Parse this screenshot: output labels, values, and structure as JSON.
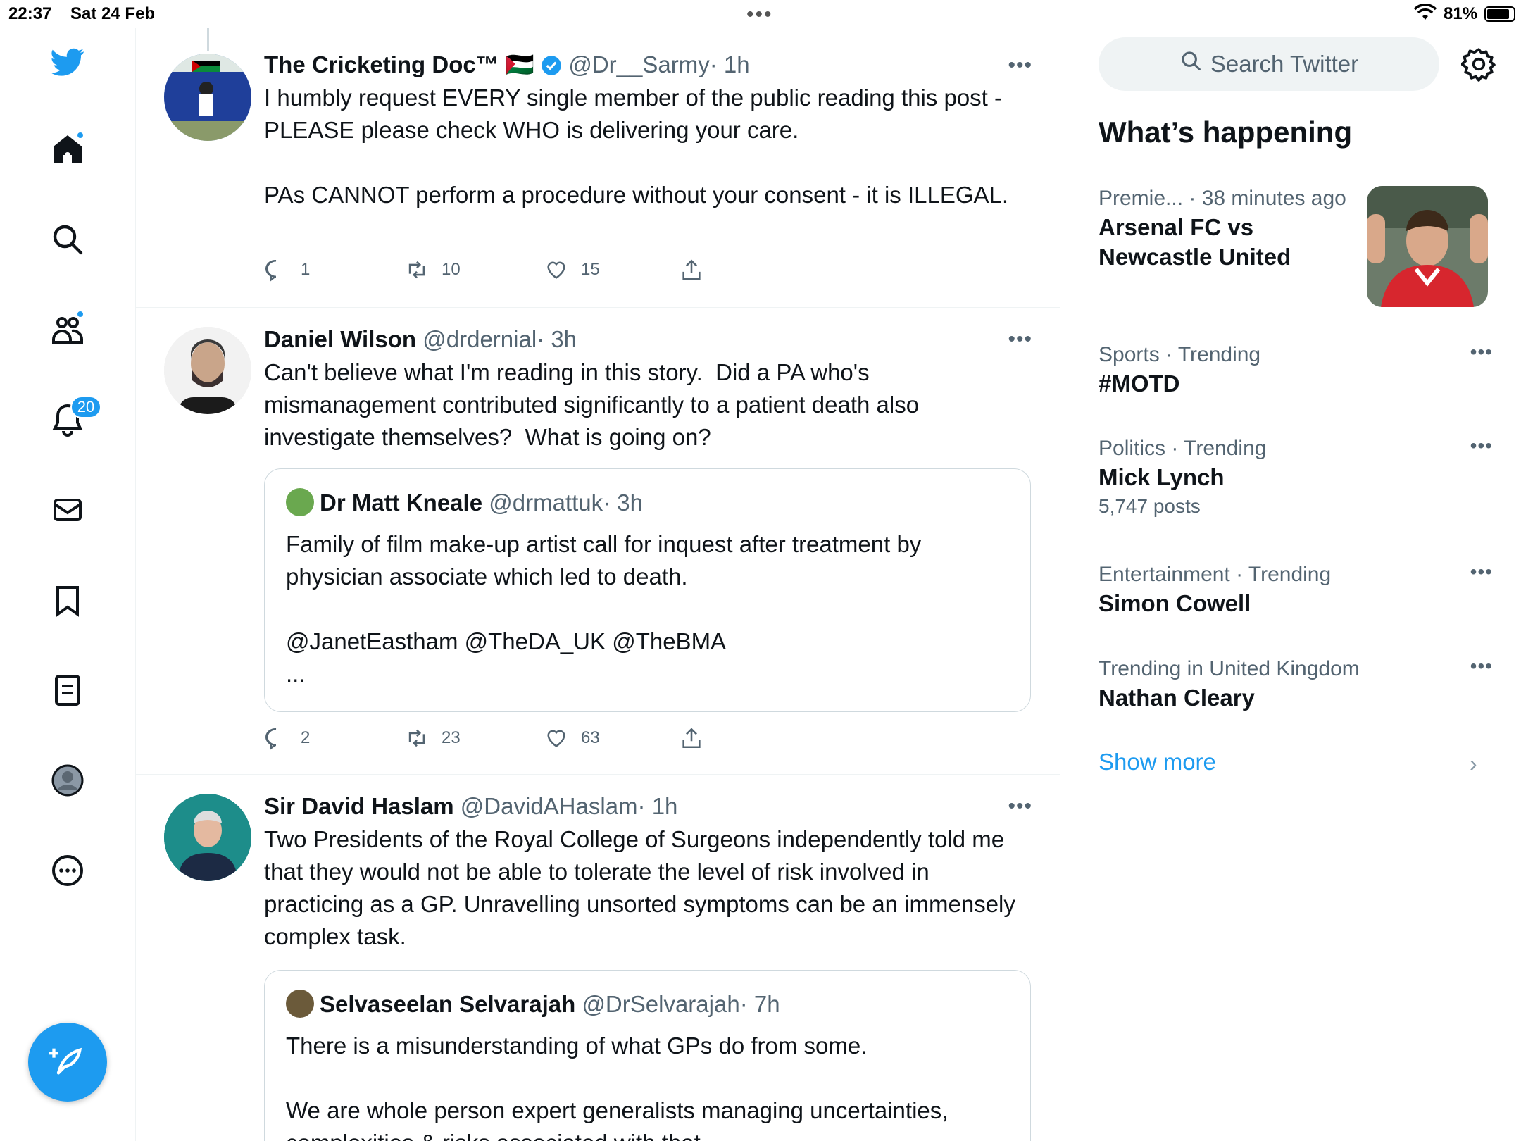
{
  "statusbar": {
    "time": "22:37",
    "date": "Sat 24 Feb",
    "battery": "81%",
    "battery_level": 0.81
  },
  "nav": {
    "items": [
      {
        "name": "twitter-logo-icon"
      },
      {
        "name": "home-icon",
        "dot": true
      },
      {
        "name": "search-icon"
      },
      {
        "name": "communities-icon",
        "dot": true
      },
      {
        "name": "bell-icon",
        "badge": "20"
      },
      {
        "name": "mail-icon"
      },
      {
        "name": "bookmark-icon"
      },
      {
        "name": "lists-icon"
      },
      {
        "name": "profile-icon"
      },
      {
        "name": "more-circle-icon"
      }
    ],
    "compose_icon": "compose-feather-icon"
  },
  "tweets": [
    {
      "name": "The Cricketing Doc™",
      "flag": "🇵🇸",
      "verified": true,
      "handle": "@Dr__Sarmy",
      "time": "· 1h",
      "text": "I humbly request EVERY single member of the public reading this post - PLEASE please check WHO is delivering your care.\n\nPAs CANNOT perform a procedure without your consent - it is ILLEGAL.",
      "replies": "1",
      "retweets": "10",
      "likes": "15"
    },
    {
      "name": "Daniel Wilson",
      "handle": "@drdernial",
      "time": "· 3h",
      "text": "Can't believe what I'm reading in this story.  Did a PA who's mismanagement contributed significantly to a patient death also investigate themselves?  What is going on?",
      "quote": {
        "name": "Dr Matt Kneale",
        "handle": "@drmattuk",
        "time": "· 3h",
        "text": "Family of film make-up artist call for inquest after treatment by physician associate which led to death.\n\n@JanetEastham @TheDA_UK @TheBMA\n..."
      },
      "replies": "2",
      "retweets": "23",
      "likes": "63"
    },
    {
      "name": "Sir David Haslam",
      "handle": "@DavidAHaslam",
      "time": "· 1h",
      "text": "Two Presidents of the Royal College of Surgeons independently told me that they would not be able to tolerate the level of risk involved in practicing as a GP. Unravelling unsorted symptoms can be an immensely complex task.",
      "quote": {
        "name": "Selvaseelan Selvarajah",
        "handle": "@DrSelvarajah",
        "time": "· 7h",
        "text": "There is a misunderstanding of what GPs do from some.\n\nWe are whole person expert generalists managing uncertainties, complexities & risks associated with that."
      }
    }
  ],
  "sidebar": {
    "search_placeholder": "Search Twitter",
    "title": "What’s happening",
    "featured": {
      "meta_category": "Premie...",
      "meta_time": "· 38 minutes ago",
      "topic": "Arsenal FC vs Newcastle United"
    },
    "trends": [
      {
        "meta": "Sports · Trending",
        "topic": "#MOTD",
        "sub": ""
      },
      {
        "meta": "Politics · Trending",
        "topic": "Mick Lynch",
        "sub": "5,747 posts"
      },
      {
        "meta": "Entertainment · Trending",
        "topic": "Simon Cowell",
        "sub": ""
      },
      {
        "meta": "Trending in United Kingdom",
        "topic": "Nathan Cleary",
        "sub": ""
      }
    ],
    "show_more": "Show more"
  },
  "colors": {
    "accent": "#1d9bf0",
    "text": "#0f1419",
    "muted": "#536471",
    "border": "#eff3f4"
  }
}
